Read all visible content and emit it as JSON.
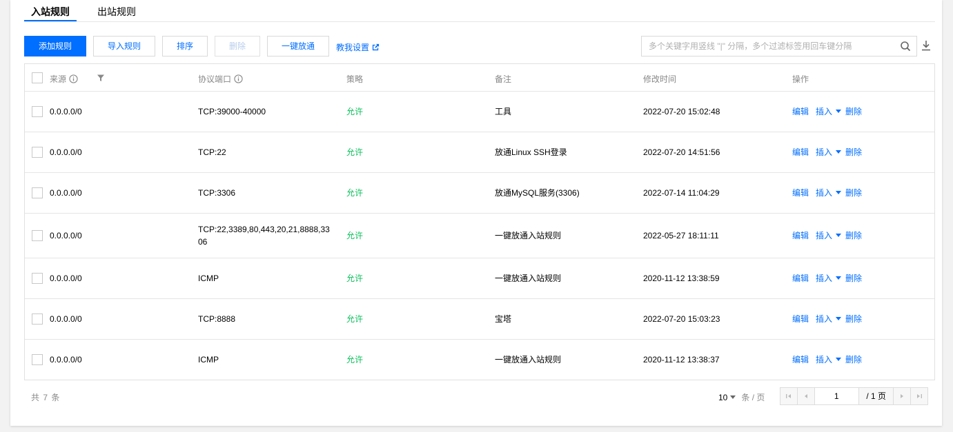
{
  "tabs": [
    {
      "label": "入站规则",
      "active": true
    },
    {
      "label": "出站规则",
      "active": false
    }
  ],
  "toolbar": {
    "add_label": "添加规则",
    "import_label": "导入规则",
    "sort_label": "排序",
    "delete_label": "删除",
    "open_all_label": "一键放通",
    "help_label": "教我设置"
  },
  "search": {
    "placeholder": "多个关键字用竖线 \"|\" 分隔，多个过滤标签用回车键分隔"
  },
  "table": {
    "headers": {
      "source": "来源",
      "protocol_port": "协议端口",
      "policy": "策略",
      "remark": "备注",
      "modified": "修改时间",
      "ops": "操作"
    },
    "rows": [
      {
        "source": "0.0.0.0/0",
        "port": "TCP:39000-40000",
        "policy": "允许",
        "remark": "工具",
        "time": "2022-07-20 15:02:48"
      },
      {
        "source": "0.0.0.0/0",
        "port": "TCP:22",
        "policy": "允许",
        "remark": "放通Linux SSH登录",
        "time": "2022-07-20 14:51:56"
      },
      {
        "source": "0.0.0.0/0",
        "port": "TCP:3306",
        "policy": "允许",
        "remark": "放通MySQL服务(3306)",
        "time": "2022-07-14 11:04:29"
      },
      {
        "source": "0.0.0.0/0",
        "port_line1": "TCP:22,3389,80,443,20,21,8888,33",
        "port_line2": "06",
        "policy": "允许",
        "remark": "一键放通入站规则",
        "time": "2022-05-27 18:11:11"
      },
      {
        "source": "0.0.0.0/0",
        "port": "ICMP",
        "policy": "允许",
        "remark": "一键放通入站规则",
        "time": "2020-11-12 13:38:59"
      },
      {
        "source": "0.0.0.0/0",
        "port": "TCP:8888",
        "policy": "允许",
        "remark": "宝塔",
        "time": "2022-07-20 15:03:23"
      },
      {
        "source": "0.0.0.0/0",
        "port": "ICMP",
        "policy": "允许",
        "remark": "一键放通入站规则",
        "time": "2020-11-12 13:38:37"
      }
    ],
    "op_labels": {
      "edit": "编辑",
      "insert": "插入",
      "delete": "删除"
    }
  },
  "footer": {
    "total": "共 7 条",
    "page_size": "10",
    "page_size_unit": "条 / 页",
    "current_page": "1",
    "total_pages": "/ 1 页"
  },
  "colors": {
    "primary": "#006eff",
    "allow": "#0abf5b"
  }
}
